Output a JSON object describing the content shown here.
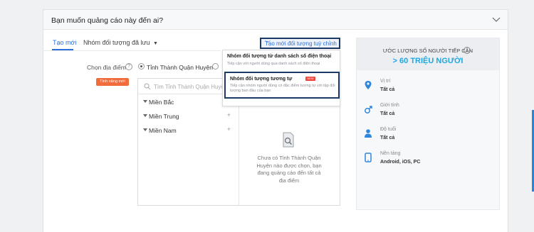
{
  "header": {
    "title": "Bạn muốn quảng cáo này đến ai?"
  },
  "tabs": [
    {
      "label": "Tạo mới"
    },
    {
      "label": "Nhóm đối tượng đã lưu"
    }
  ],
  "custom_button": {
    "label": "Tạo mới đối tượng tuỳ chỉnh"
  },
  "dropdown": {
    "items": [
      {
        "title": "Nhóm đối tượng từ danh sách số điện thoại",
        "desc": "Tiếp cận với người dùng qua danh sách số điện thoại"
      },
      {
        "title": "Nhóm đối tượng tương tự",
        "badge": "NEW",
        "desc": "Tiếp cận nhóm người dùng có đặc điểm tương tự với tập đối tượng ban đầu của bạn"
      }
    ]
  },
  "location": {
    "label": "Chọn địa điểm",
    "radio_label": "Tỉnh Thành Quận Huyện",
    "new_badge": "Tính năng mới",
    "search_placeholder": "Tìm Tỉnh Thành Quận Huyện",
    "regions": [
      {
        "name": "Miền Bắc"
      },
      {
        "name": "Miền Trung"
      },
      {
        "name": "Miền Nam"
      }
    ],
    "empty_text": "Chưa có Tỉnh Thành Quận Huyện nào được chọn, bạn đang quảng cáo đến tất cả địa điểm"
  },
  "reach": {
    "title": "ƯỚC LƯỢNG SỐ NGƯỜI TIẾP CẬN",
    "value": "> 60 TRIỆU NGƯỜI",
    "stats": [
      {
        "label": "Vị trí",
        "value": "Tất cả",
        "icon": "location-pin-icon"
      },
      {
        "label": "Giới tính",
        "value": "Tất cả",
        "icon": "gender-icon"
      },
      {
        "label": "Độ tuổi",
        "value": "Tất cả",
        "icon": "person-icon"
      },
      {
        "label": "Nền tảng",
        "value": "Android, iOS, PC",
        "icon": "device-icon"
      }
    ]
  },
  "colors": {
    "accent": "#2e6fd8",
    "reach_value": "#1fa7e0",
    "badge": "#f26b3a",
    "highlight_border": "#1d3a66"
  }
}
